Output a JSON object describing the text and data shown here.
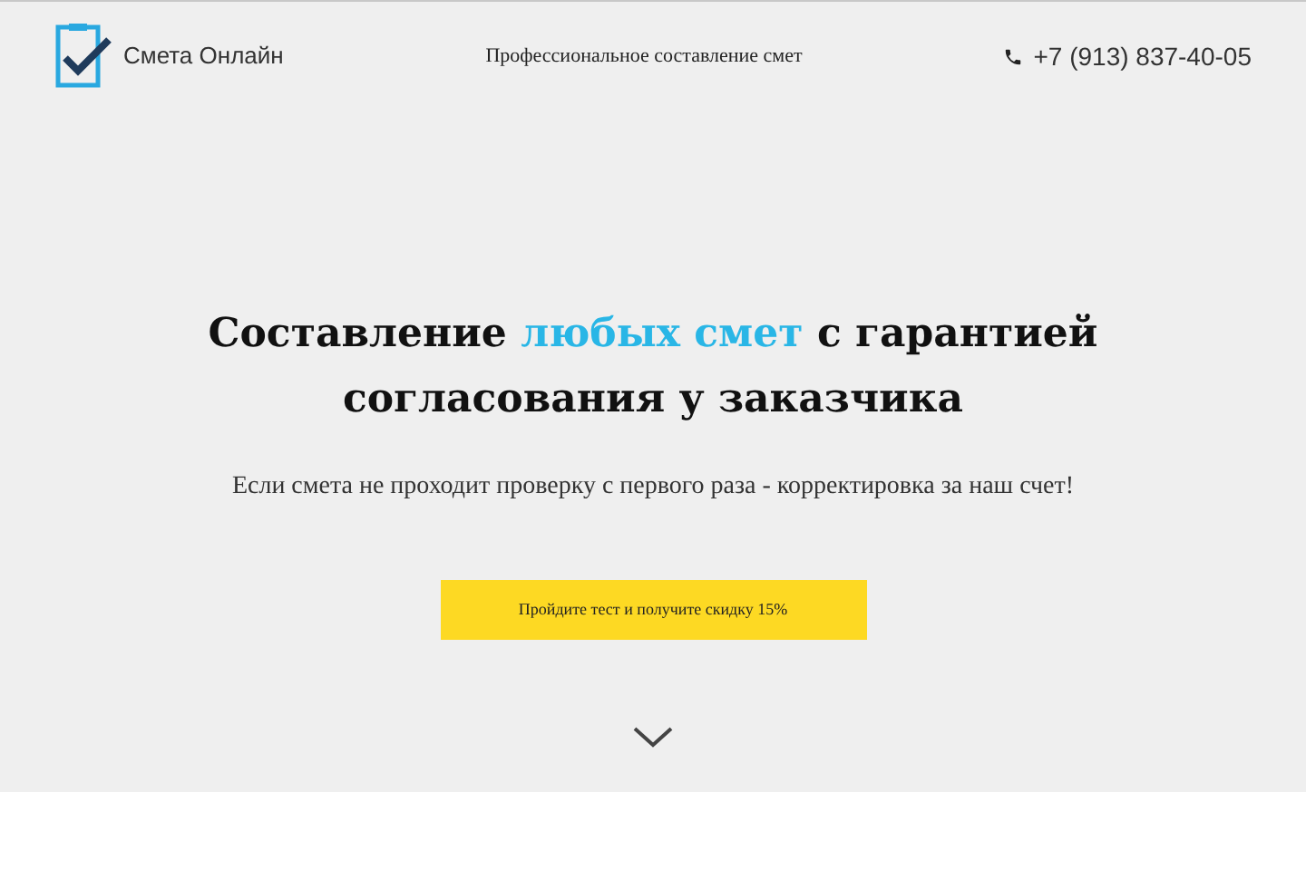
{
  "header": {
    "logo_text": "Смета Онлайн",
    "tagline": "Профессиональное составление смет",
    "phone": "+7 (913) 837-40-05"
  },
  "hero": {
    "headline": [
      {
        "text": "Составление ",
        "accent": false
      },
      {
        "text": "любых смет",
        "accent": true
      },
      {
        "text": " с гарантией согласования у заказчика",
        "accent": false
      }
    ],
    "subtitle": "Если смета не проходит проверку с первого раза - корректировка за наш счет!",
    "cta_button": "Пройдите тест и получите скидку 15%"
  }
}
